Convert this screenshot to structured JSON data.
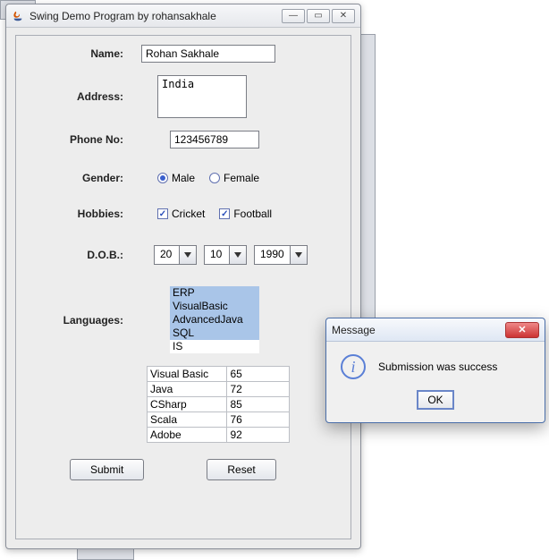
{
  "window": {
    "title": "Swing Demo Program by rohansakhale"
  },
  "labels": {
    "name": "Name:",
    "address": "Address:",
    "phone": "Phone No:",
    "gender": "Gender:",
    "hobbies": "Hobbies:",
    "dob": "D.O.B.:",
    "languages": "Languages:"
  },
  "values": {
    "name": "Rohan Sakhale",
    "address": "India",
    "phone": "123456789"
  },
  "gender": {
    "male": "Male",
    "female": "Female",
    "selected": "male"
  },
  "hobbies": {
    "cricket": {
      "label": "Cricket",
      "checked": true
    },
    "football": {
      "label": "Football",
      "checked": true
    }
  },
  "dob": {
    "day": "20",
    "month": "10",
    "year": "1990"
  },
  "languages": {
    "items": [
      "ERP",
      "VisualBasic",
      "AdvancedJava",
      "SQL",
      "IS"
    ],
    "selected": [
      0,
      1,
      2,
      3
    ]
  },
  "table": {
    "rows": [
      {
        "c0": "Visual Basic",
        "c1": "65"
      },
      {
        "c0": "Java",
        "c1": "72"
      },
      {
        "c0": "CSharp",
        "c1": "85"
      },
      {
        "c0": "Scala",
        "c1": "76"
      },
      {
        "c0": "Adobe",
        "c1": "92"
      }
    ]
  },
  "buttons": {
    "submit": "Submit",
    "reset": "Reset"
  },
  "dialog": {
    "title": "Message",
    "text": "Submission was success",
    "ok": "OK"
  }
}
